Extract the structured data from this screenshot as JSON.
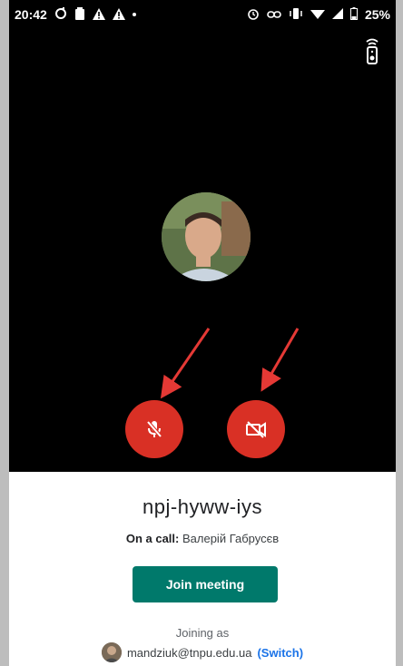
{
  "status_bar": {
    "time": "20:42",
    "battery": "25%"
  },
  "icons": {
    "mic": "mic-off-icon",
    "camera": "videocam-off-icon",
    "audio_output": "speaker-icon"
  },
  "meeting": {
    "code": "npj-hyww-iys",
    "on_call_label": "On a call:",
    "on_call_name": "Валерій Габрусєв",
    "join_label": "Join meeting",
    "joining_as": "Joining as",
    "account_email": "mandziuk@tnpu.edu.ua",
    "switch_label": "Switch"
  },
  "colors": {
    "control_red": "#d93025",
    "join_green": "#00796b",
    "link_blue": "#1a73e8",
    "arrow_red": "#e53935"
  }
}
